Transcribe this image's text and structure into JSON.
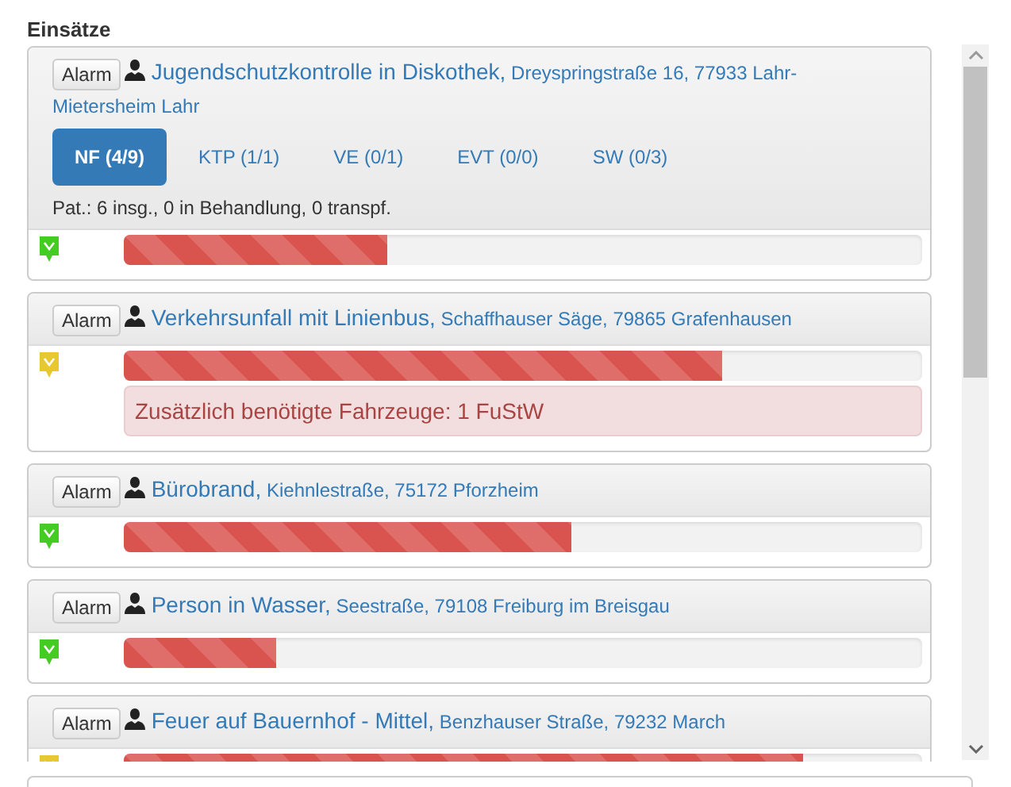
{
  "heading": "Einsätze",
  "incidents": [
    {
      "button": "Alarm",
      "title": "Jugendschutzkontrolle in Diskothek,",
      "address": [
        "Dreyspringstraße 16, 77933 Lahr-",
        "Mietersheim Lahr"
      ],
      "color": "#44cc22",
      "level": 0.33,
      "tabs": [
        {
          "label": "NF (4/9)",
          "selected": true
        },
        {
          "label": "KTP (1/1)",
          "selected": false
        },
        {
          "label": "VE (0/1)",
          "selected": false
        },
        {
          "label": "EVT (0/0)",
          "selected": false
        },
        {
          "label": "SW (0/3)",
          "selected": false
        }
      ],
      "patients": "Pat.: 6 insg., 0 in Behandlung, 0 transpf."
    },
    {
      "button": "Alarm",
      "title": "Verkehrsunfall mit Linienbus,",
      "address": [
        "Schaffhauser Säge, 79865 Grafenhausen"
      ],
      "color": "#e8c830",
      "level": 0.75,
      "alert": "Zusätzlich benötigte Fahrzeuge: 1 FuStW"
    },
    {
      "button": "Alarm",
      "title": "Bürobrand,",
      "address": [
        "Kiehnlestraße, 75172 Pforzheim"
      ],
      "color": "#44cc22",
      "level": 0.56
    },
    {
      "button": "Alarm",
      "title": "Person in Wasser,",
      "address": [
        "Seestraße, 79108 Freiburg im Breisgau"
      ],
      "color": "#44cc22",
      "level": 0.19
    },
    {
      "button": "Alarm",
      "title": "Feuer auf Bauernhof - Mittel,",
      "address": [
        "Benzhauser Straße, 79232 March"
      ],
      "color": "#e8c830",
      "level": 0.85
    }
  ]
}
